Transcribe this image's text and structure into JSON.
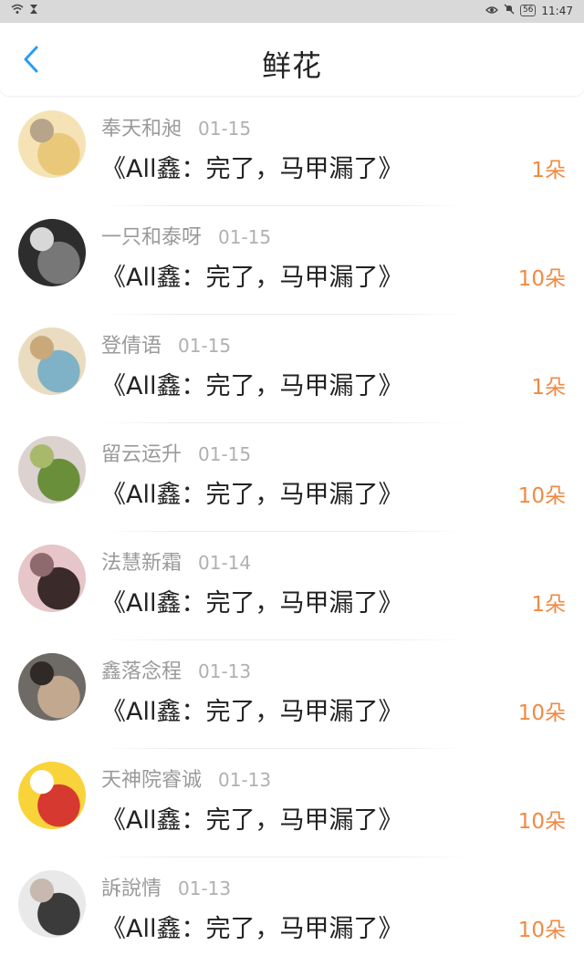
{
  "status_bar": {
    "time": "11:47",
    "battery": "56"
  },
  "header": {
    "title": "鲜花"
  },
  "rows": [
    {
      "name": "奉天和昶",
      "date": "01-15",
      "book": "《All鑫：完了，马甲漏了》",
      "count": "1朵",
      "avatar_colors": [
        "#f5e3b6",
        "#e9c979",
        "#b7a48a"
      ]
    },
    {
      "name": "一只和泰呀",
      "date": "01-15",
      "book": "《All鑫：完了，马甲漏了》",
      "count": "10朵",
      "avatar_colors": [
        "#2d2d2d",
        "#777777",
        "#d8d8d8"
      ]
    },
    {
      "name": "登倩语",
      "date": "01-15",
      "book": "《All鑫：完了，马甲漏了》",
      "count": "1朵",
      "avatar_colors": [
        "#e9dcc0",
        "#7fb2c6",
        "#c9a97a"
      ]
    },
    {
      "name": "留云运升",
      "date": "01-15",
      "book": "《All鑫：完了，马甲漏了》",
      "count": "10朵",
      "avatar_colors": [
        "#dcd2d0",
        "#6a8f3a",
        "#a9b96b"
      ]
    },
    {
      "name": "法慧新霜",
      "date": "01-14",
      "book": "《All鑫：完了，马甲漏了》",
      "count": "1朵",
      "avatar_colors": [
        "#e6c6c8",
        "#3a2a2a",
        "#8e6a6e"
      ]
    },
    {
      "name": "鑫落念程",
      "date": "01-13",
      "book": "《All鑫：完了，马甲漏了》",
      "count": "10朵",
      "avatar_colors": [
        "#6e6a66",
        "#c2a88f",
        "#2f2a28"
      ]
    },
    {
      "name": "天神院睿诚",
      "date": "01-13",
      "book": "《All鑫：完了，马甲漏了》",
      "count": "10朵",
      "avatar_colors": [
        "#f8d43a",
        "#d6392f",
        "#ffffff"
      ]
    },
    {
      "name": "訴說情",
      "date": "01-13",
      "book": "《All鑫：完了，马甲漏了》",
      "count": "10朵",
      "avatar_colors": [
        "#e9e9e9",
        "#3b3b3b",
        "#c7b8b0"
      ]
    }
  ],
  "colors": {
    "accent_count": "#f08a42",
    "back_arrow": "#2a9df4"
  }
}
